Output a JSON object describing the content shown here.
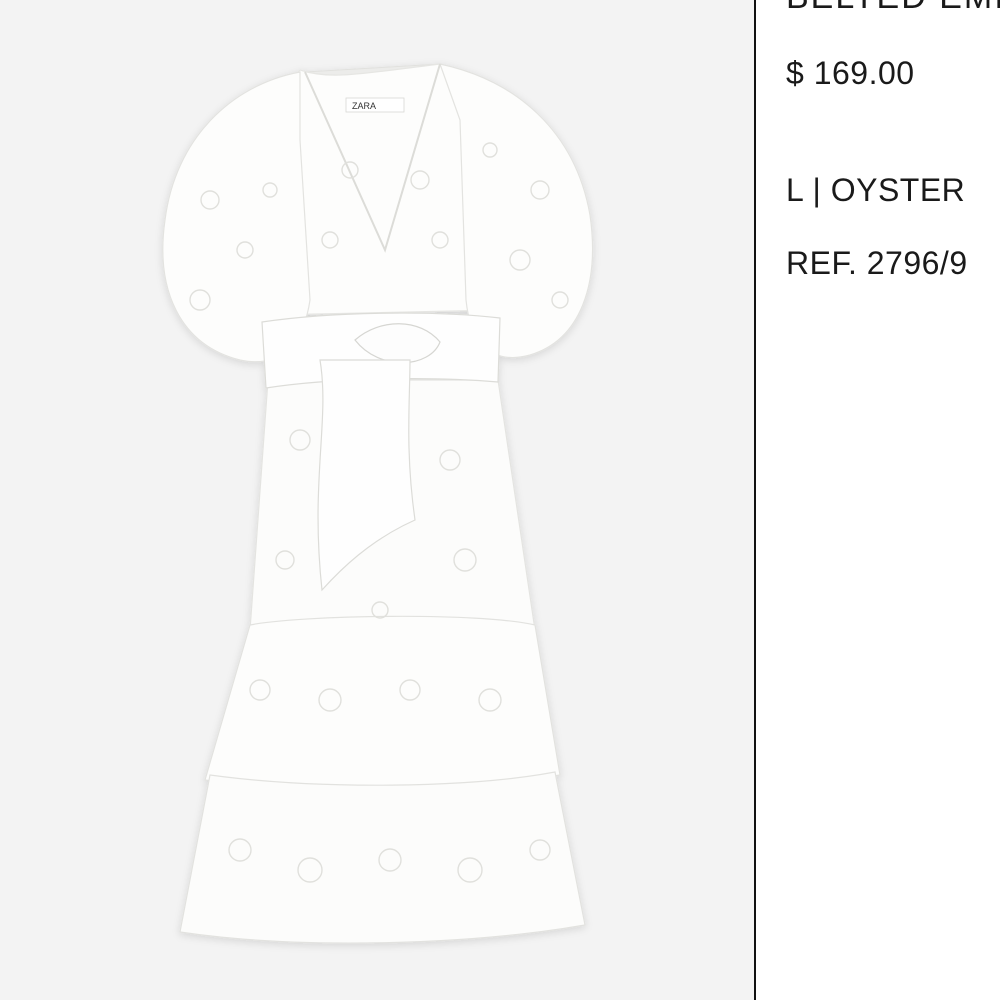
{
  "product": {
    "title": "BELTED EMI",
    "price": "$ 169.00",
    "variant": "L | OYSTER",
    "reference": "REF. 2796/9"
  },
  "image": {
    "brand_tag": "ZARA",
    "background_color": "#f3f3f3",
    "garment_color": "#ffffff"
  }
}
